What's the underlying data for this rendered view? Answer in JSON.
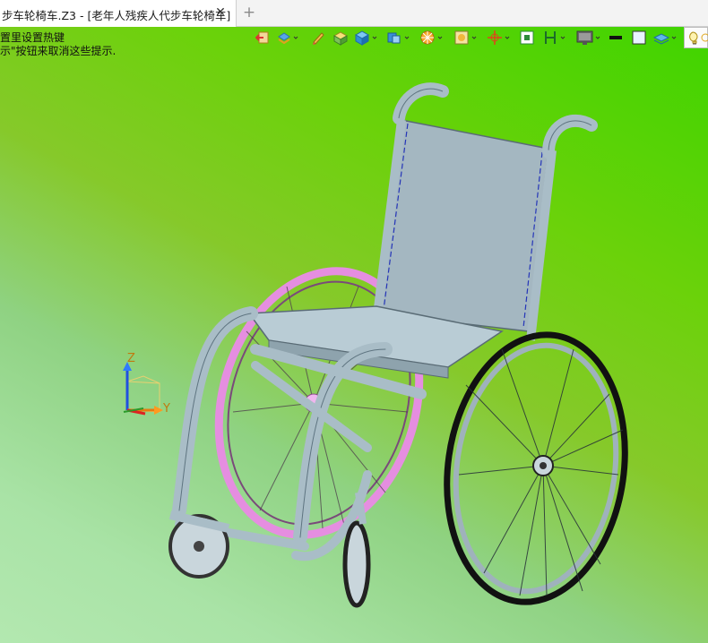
{
  "tab": {
    "title": "步车轮椅车.Z3 - [老年人残疾人代步车轮椅车]",
    "close_glyph": "✕"
  },
  "new_tab_glyph": "+",
  "hints": {
    "line1": "置里设置热键",
    "line2": "示\"按钮来取消这些提示."
  },
  "axis": {
    "z_label": "Z",
    "y_label": "Y"
  },
  "colors": {
    "background_top": "#3fd400",
    "background_bottom": "#b3e8b0",
    "frame": "#a9bdc7",
    "wheel_accent": "#e58ee0"
  },
  "toolbar": {
    "icons": [
      "exit-view-icon",
      "layers-icon",
      "pencil-icon",
      "folder-cube-icon",
      "cube-icon",
      "cube-copy-icon",
      "render-mode-icon",
      "frame-icon",
      "axis-icon",
      "select-icon",
      "measure-icon",
      "monitor-icon",
      "line-color-icon",
      "fill-color-icon",
      "layer-plane-icon",
      "light-bulb-icon"
    ]
  }
}
